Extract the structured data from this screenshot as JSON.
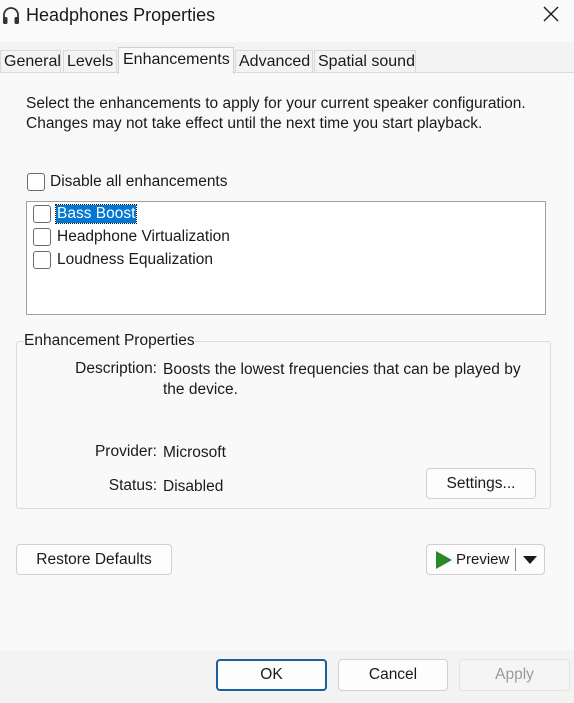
{
  "window": {
    "title": "Headphones Properties"
  },
  "tabs": [
    {
      "label": "General"
    },
    {
      "label": "Levels"
    },
    {
      "label": "Enhancements"
    },
    {
      "label": "Advanced"
    },
    {
      "label": "Spatial sound"
    }
  ],
  "active_tab": "Enhancements",
  "enhancements": {
    "intro": "Select the enhancements to apply for your current speaker configuration. Changes may not take effect until the next time you start playback.",
    "disable_all_label": "Disable all enhancements",
    "disable_all_checked": false,
    "items": [
      {
        "label": "Bass Boost",
        "checked": false,
        "selected": true
      },
      {
        "label": "Headphone Virtualization",
        "checked": false,
        "selected": false
      },
      {
        "label": "Loudness Equalization",
        "checked": false,
        "selected": false
      }
    ]
  },
  "properties": {
    "group_title": "Enhancement Properties",
    "description_label": "Description:",
    "description_value": "Boosts the lowest frequencies that can be played by the device.",
    "provider_label": "Provider:",
    "provider_value": "Microsoft",
    "status_label": "Status:",
    "status_value": "Disabled",
    "settings_button": "Settings..."
  },
  "actions": {
    "restore_defaults": "Restore Defaults",
    "preview": "Preview"
  },
  "footer": {
    "ok": "OK",
    "cancel": "Cancel",
    "apply": "Apply",
    "apply_enabled": false
  },
  "icons": {
    "app": "headphones-icon",
    "close": "close-icon",
    "play": "play-icon",
    "dropdown": "chevron-down-icon"
  },
  "colors": {
    "selection": "#0078d4",
    "play": "#2a8a2a",
    "default_button_border": "#1f5f97"
  }
}
